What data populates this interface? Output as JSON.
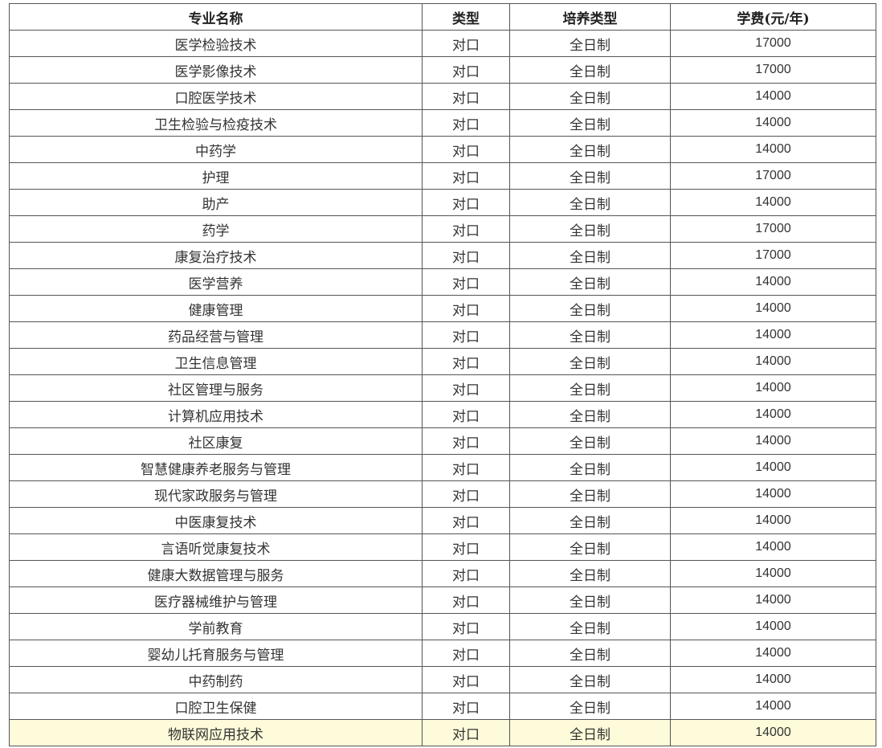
{
  "header": {
    "name": "专业名称",
    "type": "类型",
    "mode": "培养类型",
    "fee": "学费(元/年)"
  },
  "rows": [
    {
      "name": "医学检验技术",
      "type": "对口",
      "mode": "全日制",
      "fee": "17000"
    },
    {
      "name": "医学影像技术",
      "type": "对口",
      "mode": "全日制",
      "fee": "17000"
    },
    {
      "name": "口腔医学技术",
      "type": "对口",
      "mode": "全日制",
      "fee": "14000"
    },
    {
      "name": "卫生检验与检疫技术",
      "type": "对口",
      "mode": "全日制",
      "fee": "14000"
    },
    {
      "name": "中药学",
      "type": "对口",
      "mode": "全日制",
      "fee": "14000"
    },
    {
      "name": "护理",
      "type": "对口",
      "mode": "全日制",
      "fee": "17000"
    },
    {
      "name": "助产",
      "type": "对口",
      "mode": "全日制",
      "fee": "14000"
    },
    {
      "name": "药学",
      "type": "对口",
      "mode": "全日制",
      "fee": "17000"
    },
    {
      "name": "康复治疗技术",
      "type": "对口",
      "mode": "全日制",
      "fee": "17000"
    },
    {
      "name": "医学营养",
      "type": "对口",
      "mode": "全日制",
      "fee": "14000"
    },
    {
      "name": "健康管理",
      "type": "对口",
      "mode": "全日制",
      "fee": "14000"
    },
    {
      "name": "药品经营与管理",
      "type": "对口",
      "mode": "全日制",
      "fee": "14000"
    },
    {
      "name": "卫生信息管理",
      "type": "对口",
      "mode": "全日制",
      "fee": "14000"
    },
    {
      "name": "社区管理与服务",
      "type": "对口",
      "mode": "全日制",
      "fee": "14000"
    },
    {
      "name": "计算机应用技术",
      "type": "对口",
      "mode": "全日制",
      "fee": "14000"
    },
    {
      "name": "社区康复",
      "type": "对口",
      "mode": "全日制",
      "fee": "14000"
    },
    {
      "name": "智慧健康养老服务与管理",
      "type": "对口",
      "mode": "全日制",
      "fee": "14000"
    },
    {
      "name": "现代家政服务与管理",
      "type": "对口",
      "mode": "全日制",
      "fee": "14000"
    },
    {
      "name": "中医康复技术",
      "type": "对口",
      "mode": "全日制",
      "fee": "14000"
    },
    {
      "name": "言语听觉康复技术",
      "type": "对口",
      "mode": "全日制",
      "fee": "14000"
    },
    {
      "name": "健康大数据管理与服务",
      "type": "对口",
      "mode": "全日制",
      "fee": "14000"
    },
    {
      "name": "医疗器械维护与管理",
      "type": "对口",
      "mode": "全日制",
      "fee": "14000"
    },
    {
      "name": "学前教育",
      "type": "对口",
      "mode": "全日制",
      "fee": "14000"
    },
    {
      "name": "婴幼儿托育服务与管理",
      "type": "对口",
      "mode": "全日制",
      "fee": "14000"
    },
    {
      "name": "中药制药",
      "type": "对口",
      "mode": "全日制",
      "fee": "14000"
    },
    {
      "name": "口腔卫生保健",
      "type": "对口",
      "mode": "全日制",
      "fee": "14000"
    },
    {
      "name": "物联网应用技术",
      "type": "对口",
      "mode": "全日制",
      "fee": "14000"
    }
  ],
  "highlight_row_index": 26,
  "colors": {
    "border": "#555555",
    "text": "#333333",
    "highlight_bg": "#fdfbd9"
  }
}
